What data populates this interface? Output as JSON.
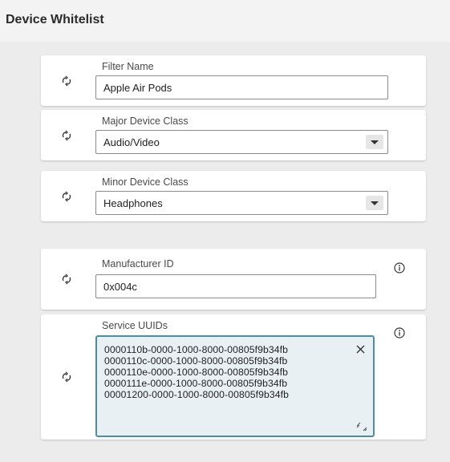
{
  "header": {
    "title": "Device Whitelist"
  },
  "fields": {
    "filter_name": {
      "label": "Filter Name",
      "value": "Apple Air Pods"
    },
    "major_device_class": {
      "label": "Major Device Class",
      "value": "Audio/Video"
    },
    "minor_device_class": {
      "label": "Minor Device Class",
      "value": "Headphones"
    },
    "manufacturer_id": {
      "label": "Manufacturer ID",
      "value": "0x004c"
    },
    "service_uuids": {
      "label": "Service UUIDs",
      "lines": [
        "0000110b-0000-1000-8000-00805f9b34fb",
        "0000110c-0000-1000-8000-00805f9b34fb",
        "0000110e-0000-1000-8000-00805f9b34fb",
        "0000111e-0000-1000-8000-00805f9b34fb",
        "00001200-0000-1000-8000-00805f9b34fb"
      ]
    }
  },
  "icons": {
    "reset": "reset-arrows-icon",
    "info": "info-circle-icon",
    "dropdown": "chevron-down-icon",
    "clear": "close-icon",
    "resize": "resize-handle-icon"
  },
  "colors": {
    "page_background": "#ececec",
    "header_background": "#f3f3f3",
    "focused_border": "#4a8fa8",
    "focused_background": "#e8f0f4"
  }
}
